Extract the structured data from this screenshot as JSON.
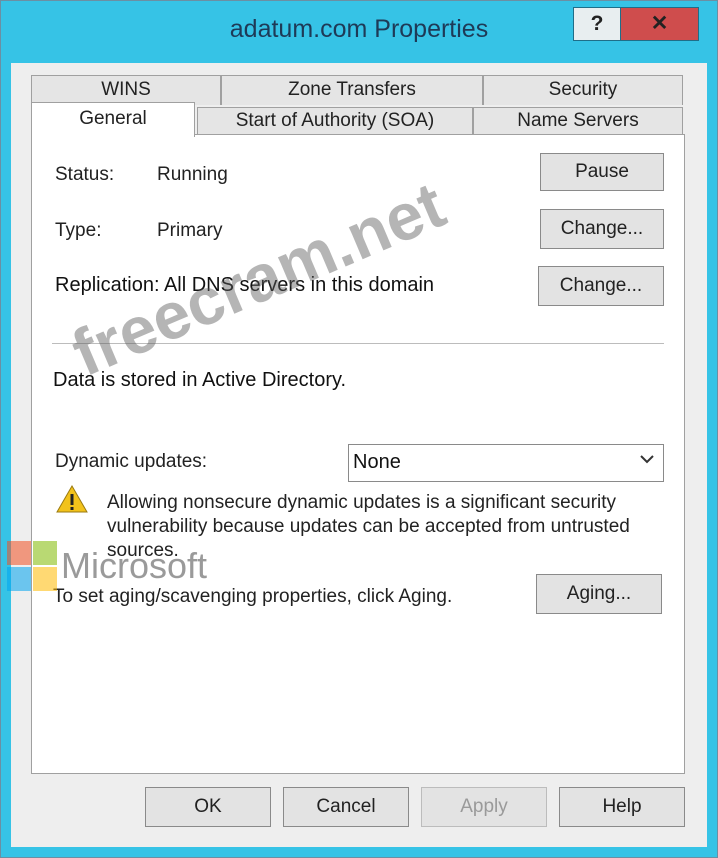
{
  "window": {
    "title": "adatum.com Properties",
    "help_label": "?",
    "close_label": "✕"
  },
  "tabs": {
    "row_back": [
      "WINS",
      "Zone Transfers",
      "Security"
    ],
    "row_front": [
      "General",
      "Start of Authority (SOA)",
      "Name Servers"
    ],
    "active": "General"
  },
  "general": {
    "status_label": "Status:",
    "status_value": "Running",
    "pause_button": "Pause",
    "type_label": "Type:",
    "type_value": "Primary",
    "type_change_button": "Change...",
    "replication_text": "Replication: All DNS servers in this domain",
    "replication_change_button": "Change...",
    "storage_text": "Data is stored in Active Directory.",
    "dynamic_updates_label": "Dynamic updates:",
    "dynamic_updates_value": "None",
    "warning_line1": "Allowing nonsecure dynamic updates is a significant security",
    "warning_line2": "vulnerability because updates can be accepted from untrusted",
    "warning_line3": "sources.",
    "aging_text": "To set aging/scavenging properties, click Aging.",
    "aging_button": "Aging..."
  },
  "footer": {
    "ok": "OK",
    "cancel": "Cancel",
    "apply": "Apply",
    "help": "Help"
  },
  "watermark": {
    "site": "freecram.net",
    "brand": "Microsoft"
  },
  "colors": {
    "title_bar": "#36c3e6",
    "close_button": "#cf4d4d",
    "warning_icon": "#f2c21b",
    "ms_red": "#f25022",
    "ms_green": "#7fba00",
    "ms_blue": "#00a4ef",
    "ms_yellow": "#ffb900"
  }
}
